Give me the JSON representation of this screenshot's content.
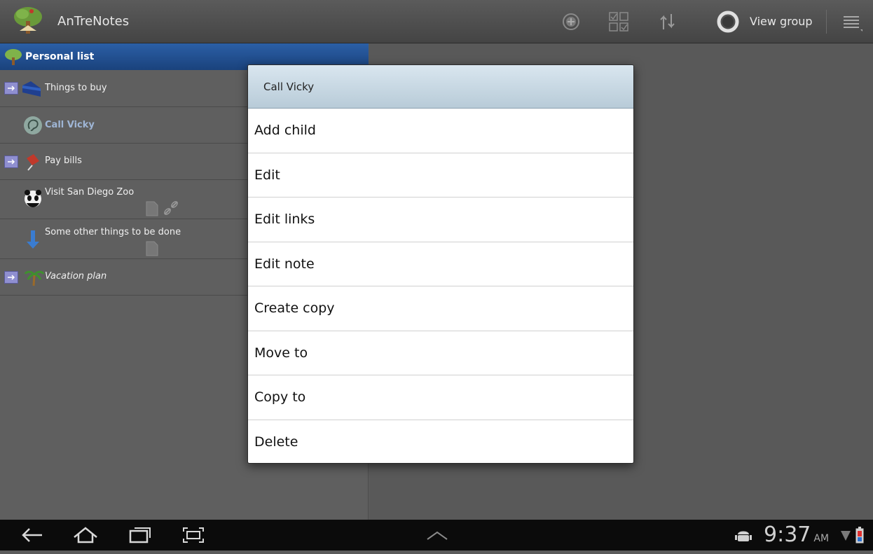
{
  "actionbar": {
    "title": "AnTreNotes",
    "app_icon": "tree-icon",
    "view_group_label": "View group",
    "icons": [
      "add-circle-icon",
      "checkbox-grid-icon",
      "sort-arrows-icon",
      "ring-icon",
      "overflow-menu-icon"
    ]
  },
  "list": {
    "header": "Personal list",
    "items": [
      {
        "label": "Things to buy",
        "icon": "folder-blue-icon",
        "expandable": true
      },
      {
        "label": "Call Vicky",
        "icon": "phone-ear-icon",
        "expandable": false
      },
      {
        "label": "Pay bills",
        "icon": "pushpin-icon",
        "expandable": true
      },
      {
        "label": "Visit San Diego Zoo",
        "icon": "panda-icon",
        "expandable": false
      },
      {
        "label": "Some other things to be done",
        "icon": "arrow-down-icon",
        "expandable": false
      },
      {
        "label": "Vacation plan",
        "icon": "palm-tree-icon",
        "expandable": true
      }
    ]
  },
  "dialog": {
    "title": "Call Vicky",
    "items": [
      "Add child",
      "Edit",
      "Edit links",
      "Edit note",
      "Create copy",
      "Move to",
      "Copy to",
      "Delete"
    ]
  },
  "statusbar": {
    "time": "9:37",
    "ampm": "AM",
    "icons": [
      "back-icon",
      "home-icon",
      "recent-apps-icon",
      "screenshot-icon",
      "chevron-up-icon",
      "android-debug-icon",
      "wifi-icon",
      "battery-icon"
    ]
  },
  "colors": {
    "header_blue": "#2b5fa6",
    "muted_label": "#9fb6d6"
  }
}
